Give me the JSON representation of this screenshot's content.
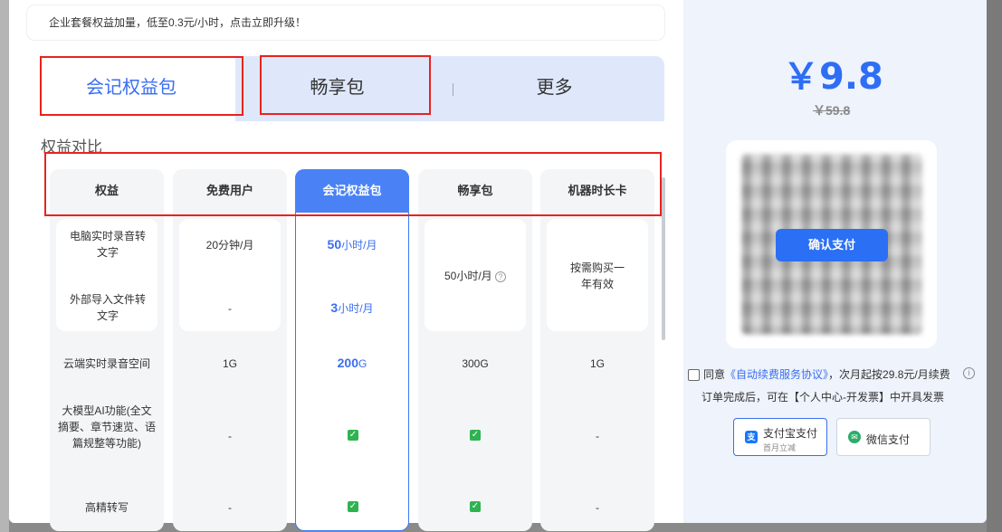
{
  "notice": "企业套餐权益加量，低至0.3元/小时，点击立即升级！",
  "tabs": [
    {
      "label": "会记权益包"
    },
    {
      "label": "畅享包"
    },
    {
      "label": "更多"
    }
  ],
  "section_title": "权益对比",
  "columns": [
    "权益",
    "免费用户",
    "会记权益包",
    "畅享包",
    "机器时长卡"
  ],
  "rows": {
    "realtime_label": "电脑实时录音转文字",
    "import_label": "外部导入文件转文字",
    "free_realtime": "20分钟/月",
    "free_import": "-",
    "pkg_realtime_num": "50",
    "pkg_realtime_unit": "小时/月",
    "pkg_import_num": "3",
    "pkg_import_unit": "小时/月",
    "enjoy_combined": "50小时/月",
    "machine_combined": "按需购买一年有效",
    "cloud_label": "云端实时录音空间",
    "cloud_free": "1G",
    "cloud_pkg_num": "200",
    "cloud_pkg_unit": "G",
    "cloud_enjoy": "300G",
    "cloud_machine": "1G",
    "ai_label": "大模型AI功能(全文摘要、章节速览、语篇规整等功能)",
    "ai_free": "-",
    "ai_machine": "-",
    "hd_label": "高精转写",
    "hd_free": "-",
    "hd_machine": "-"
  },
  "price": "￥9.8",
  "old_price": "￥59.8",
  "confirm_label": "确认支付",
  "agreement": {
    "prefix": "同意",
    "link": "《自动续费服务协议》",
    "suffix": "，次月起按29.8元/月续费"
  },
  "invoice_note": "订单完成后，可在【个人中心-开发票】中开具发票",
  "payments": [
    {
      "label": "支付宝支付",
      "sub": "首月立减",
      "icon": "alipay-icon",
      "color": "#1677ff"
    },
    {
      "label": "微信支付",
      "sub": "",
      "icon": "wechat-icon",
      "color": "#2aae67"
    }
  ],
  "accent_color": "#2e6ef5",
  "highlight_color": "#e8231e"
}
